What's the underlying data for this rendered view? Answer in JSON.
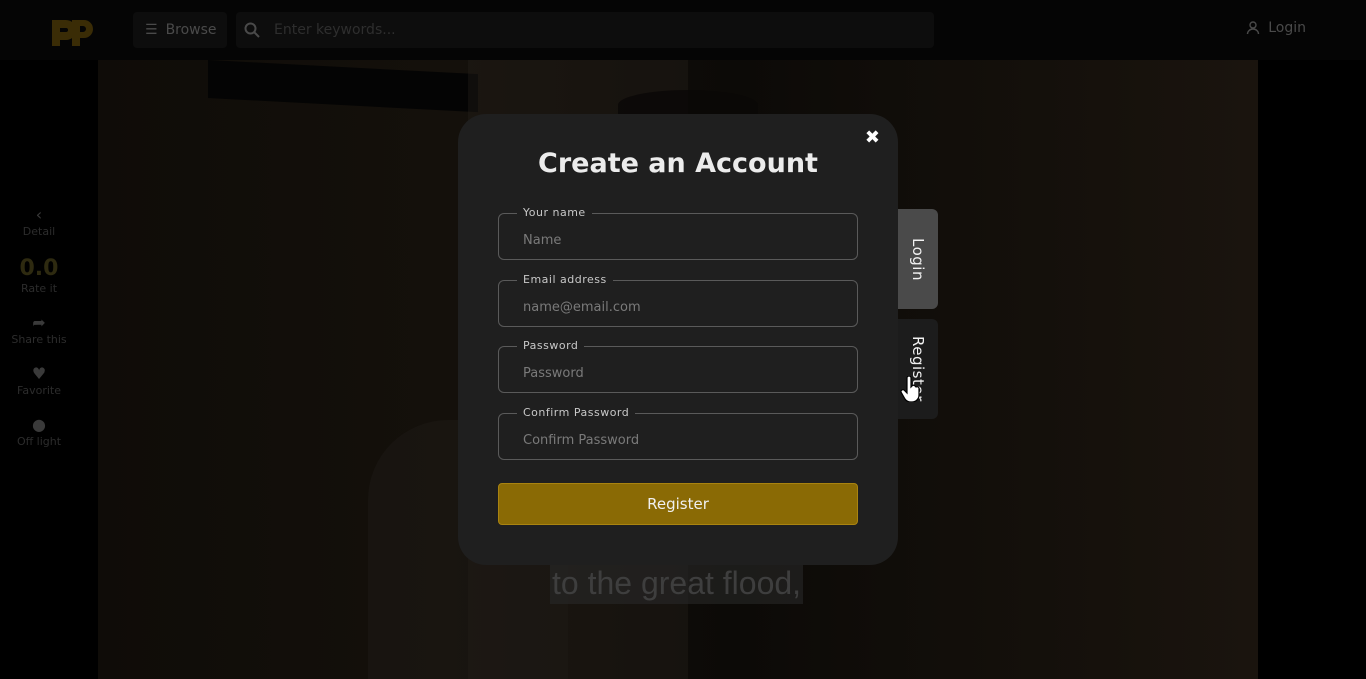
{
  "header": {
    "browse_label": "Browse",
    "search_placeholder": "Enter keywords...",
    "login_label": "Login"
  },
  "sidebar": {
    "detail_label": "Detail",
    "rating_value": "0.0",
    "rate_label": "Rate it",
    "share_label": "Share this",
    "favorite_label": "Favorite",
    "offlight_label": "Off light"
  },
  "video": {
    "subtitle": "to the great flood,"
  },
  "modal": {
    "title": "Create an Account",
    "close_symbol": "✖",
    "fields": [
      {
        "label": "Your name",
        "placeholder": "Name",
        "value": ""
      },
      {
        "label": "Email address",
        "placeholder": "name@email.com",
        "value": ""
      },
      {
        "label": "Password",
        "placeholder": "Password",
        "value": ""
      },
      {
        "label": "Confirm Password",
        "placeholder": "Confirm Password",
        "value": ""
      }
    ],
    "submit_label": "Register",
    "tabs": {
      "login": "Login",
      "register": "Register"
    }
  },
  "colors": {
    "accent": "#8a6a05",
    "modal_bg": "#1f1f1f",
    "active_tab": "#4a4a4a"
  }
}
